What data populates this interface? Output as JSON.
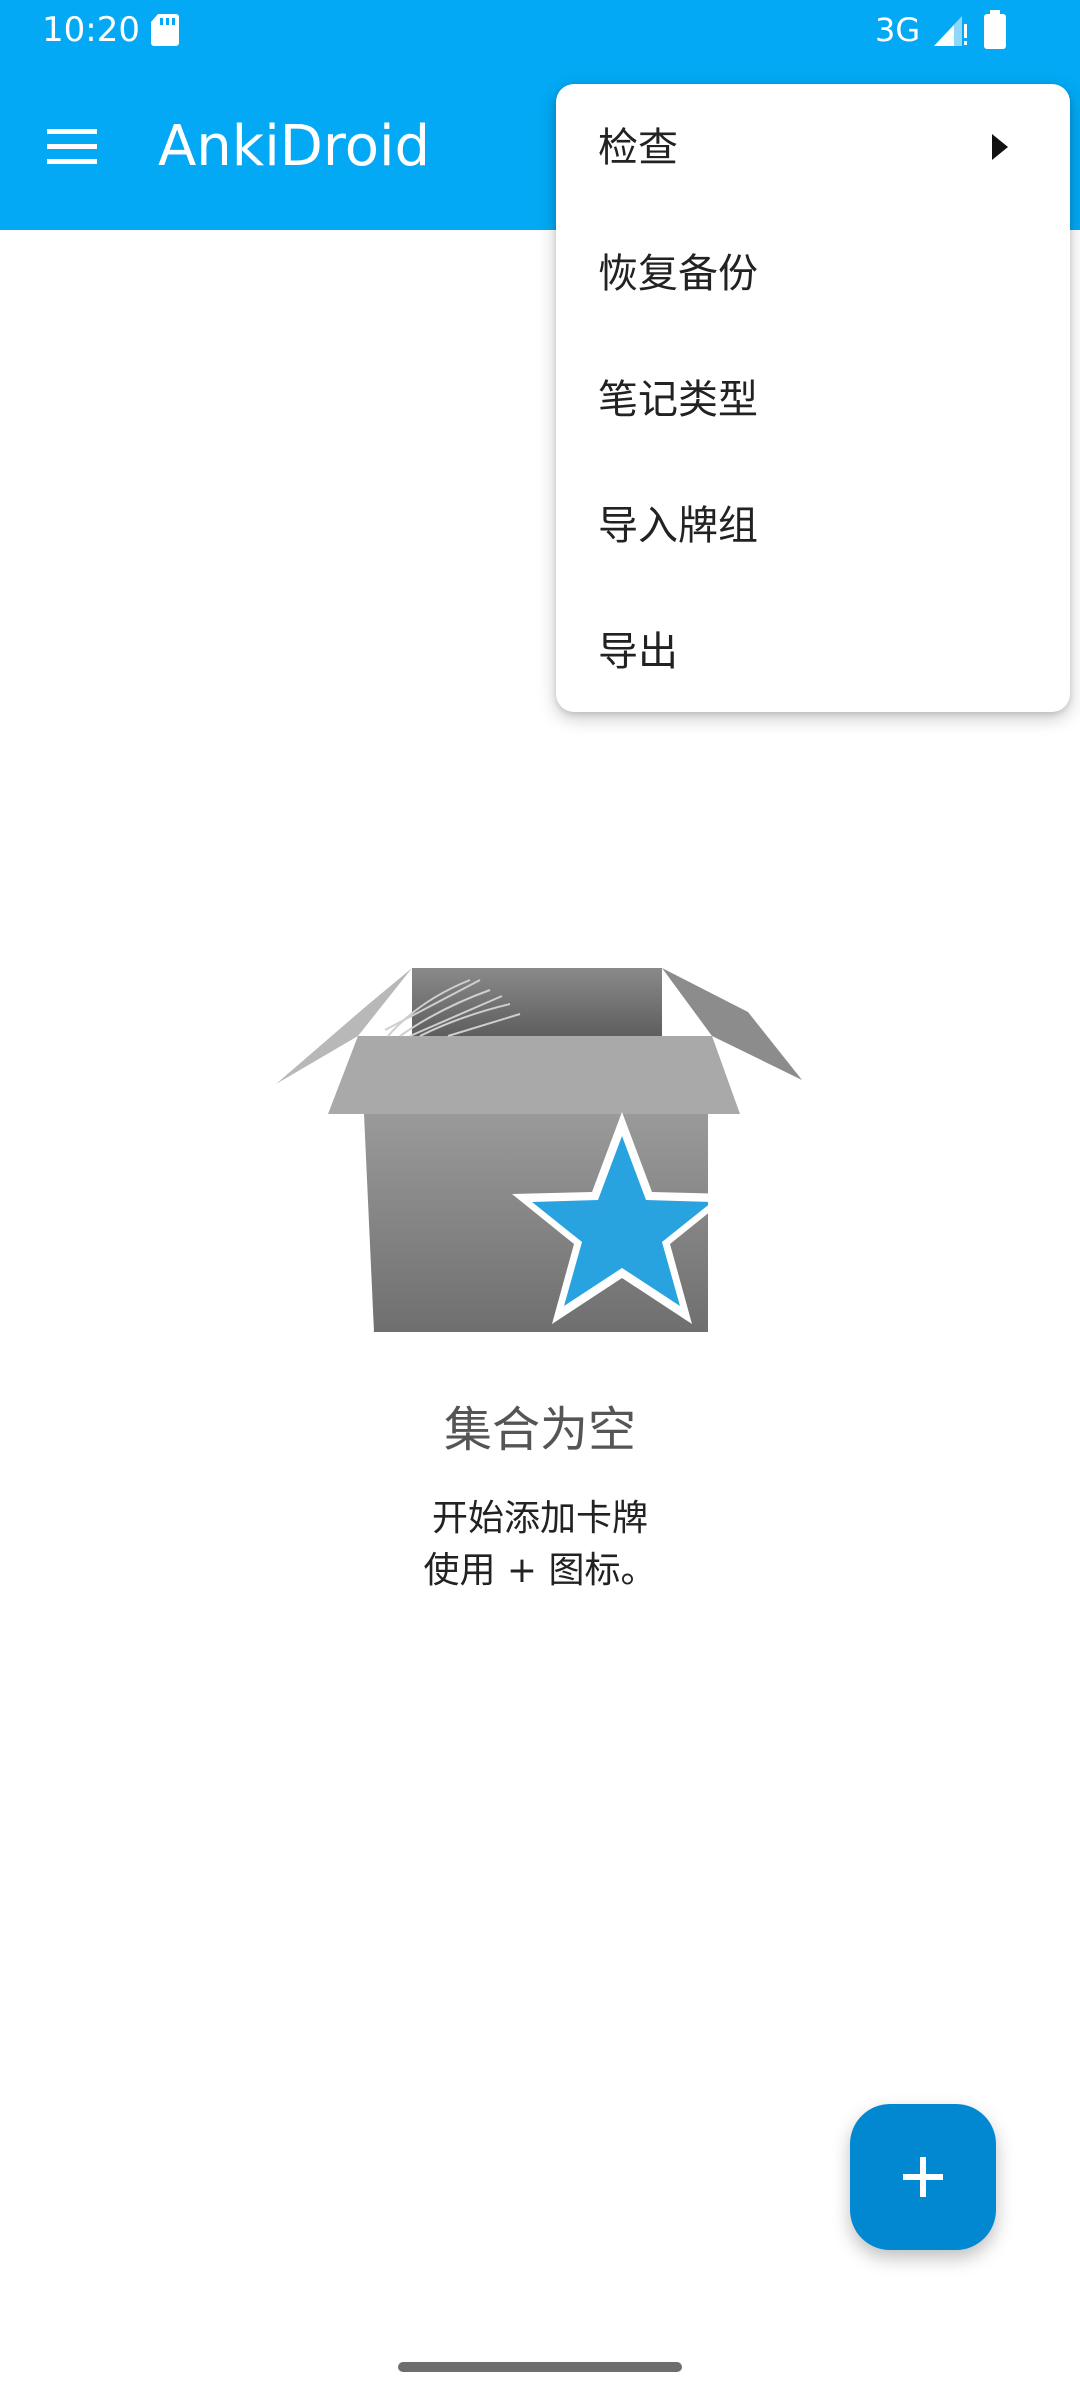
{
  "status_bar": {
    "time": "10:20",
    "network": "3G",
    "icons": [
      "sd-card-icon",
      "signal-icon",
      "battery-icon"
    ]
  },
  "app_bar": {
    "title": "AnkiDroid",
    "menu_icon": "hamburger-menu-icon",
    "color": "#03a9f4"
  },
  "overflow_menu": {
    "items": [
      {
        "label": "检查",
        "has_submenu": true
      },
      {
        "label": "恢复备份"
      },
      {
        "label": "笔记类型"
      },
      {
        "label": "导入牌组"
      },
      {
        "label": "导出"
      }
    ]
  },
  "empty_state": {
    "illustration": "empty-box-with-star-icon",
    "title": "集合为空",
    "line1": "开始添加卡牌",
    "line2": "使用 + 图标。"
  },
  "fab": {
    "icon": "plus-icon",
    "color": "#0288d1"
  }
}
